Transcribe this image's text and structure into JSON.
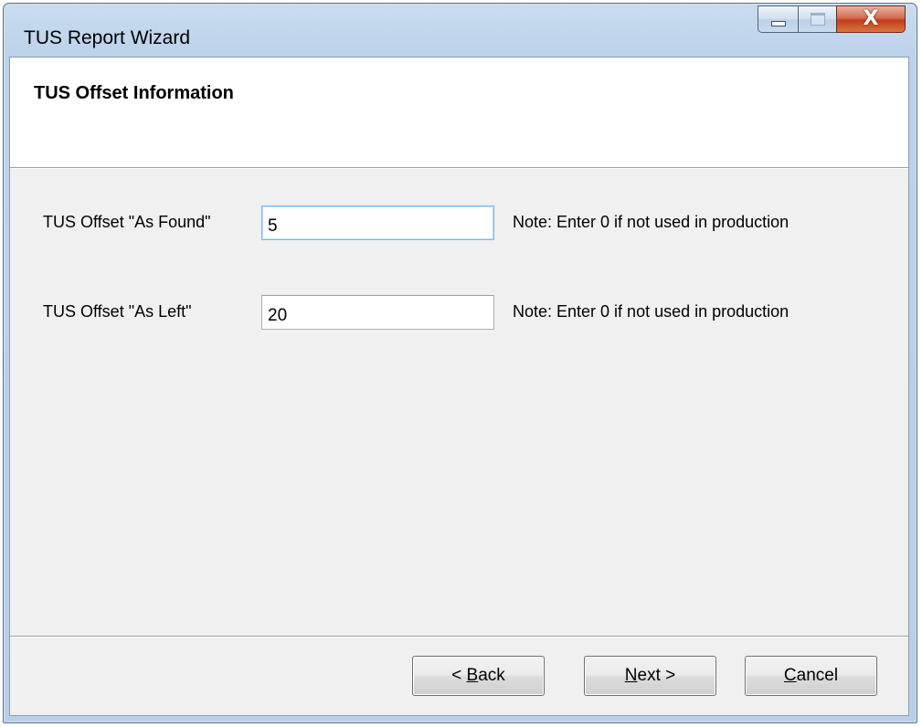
{
  "window": {
    "title": "TUS Report Wizard",
    "controls": {
      "minimize_icon": "minimize-icon",
      "maximize_icon": "maximize-icon",
      "close_icon": "close-icon",
      "close_glyph": "X"
    }
  },
  "header": {
    "title": "TUS Offset Information"
  },
  "fields": [
    {
      "label": "TUS Offset \"As Found\"",
      "value": "5",
      "note": "Note: Enter 0 if not used in production"
    },
    {
      "label": "TUS Offset \"As Left\"",
      "value": "20",
      "note": "Note: Enter 0 if not used in production"
    }
  ],
  "buttons": {
    "back": {
      "prefix": "< ",
      "accel": "B",
      "rest": "ack"
    },
    "next": {
      "prefix": "",
      "accel": "N",
      "rest": "ext >"
    },
    "cancel": {
      "prefix": "",
      "accel": "C",
      "rest": "ancel"
    }
  },
  "colors": {
    "titlebar": "#bcd2ea",
    "close_button": "#c23d1c",
    "client_background": "#f0f0f0",
    "header_background": "#ffffff"
  }
}
